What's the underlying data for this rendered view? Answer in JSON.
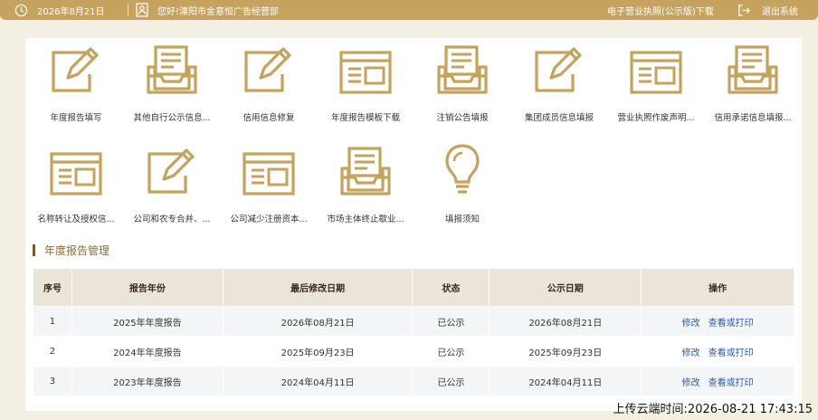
{
  "header": {
    "date": "2026年8月21日",
    "greeting": "您好!溧阳市金意恒广告经营部",
    "license_link": "电子营业执照(公示版)下载",
    "logout": "退出系统"
  },
  "colors": {
    "brand": "#c5a35f",
    "link": "#2b5ba8"
  },
  "tiles": [
    {
      "label": "年度报告填写",
      "icon": "edit-icon"
    },
    {
      "label": "其他自行公示信息...",
      "icon": "tray-icon"
    },
    {
      "label": "信用信息修复",
      "icon": "edit-icon"
    },
    {
      "label": "年度报告模板下载",
      "icon": "form-icon"
    },
    {
      "label": "注销公告填报",
      "icon": "tray-icon"
    },
    {
      "label": "集团成员信息填报",
      "icon": "edit-icon"
    },
    {
      "label": "营业执照作废声明...",
      "icon": "form-icon"
    },
    {
      "label": "信用承诺信息填报...",
      "icon": "tray-icon"
    },
    {
      "label": "名称转让及授权信...",
      "icon": "form-icon"
    },
    {
      "label": "公司和农专合并、...",
      "icon": "edit-icon"
    },
    {
      "label": "公司减少注册资本...",
      "icon": "form-icon"
    },
    {
      "label": "市场主体终止歇业...",
      "icon": "tray-icon"
    },
    {
      "label": "填报须知",
      "icon": "lightbulb-icon"
    }
  ],
  "section": {
    "title": "年度报告管理"
  },
  "table": {
    "headers": [
      "序号",
      "报告年份",
      "最后修改日期",
      "状态",
      "公示日期",
      "操作"
    ],
    "rows": [
      {
        "no": "1",
        "year": "2025年年度报告",
        "modified": "2026年08月21日",
        "status": "已公示",
        "published": "2026年08月21日",
        "edit": "修改",
        "view": "查看或打印"
      },
      {
        "no": "2",
        "year": "2024年年度报告",
        "modified": "2025年09月23日",
        "status": "已公示",
        "published": "2025年09月23日",
        "edit": "修改",
        "view": "查看或打印"
      },
      {
        "no": "3",
        "year": "2023年年度报告",
        "modified": "2024年04月11日",
        "status": "已公示",
        "published": "2024年04月11日",
        "edit": "修改",
        "view": "查看或打印"
      }
    ]
  },
  "footer": {
    "upload_time": "上传云端时间:2026-08-21 17:43:15"
  }
}
